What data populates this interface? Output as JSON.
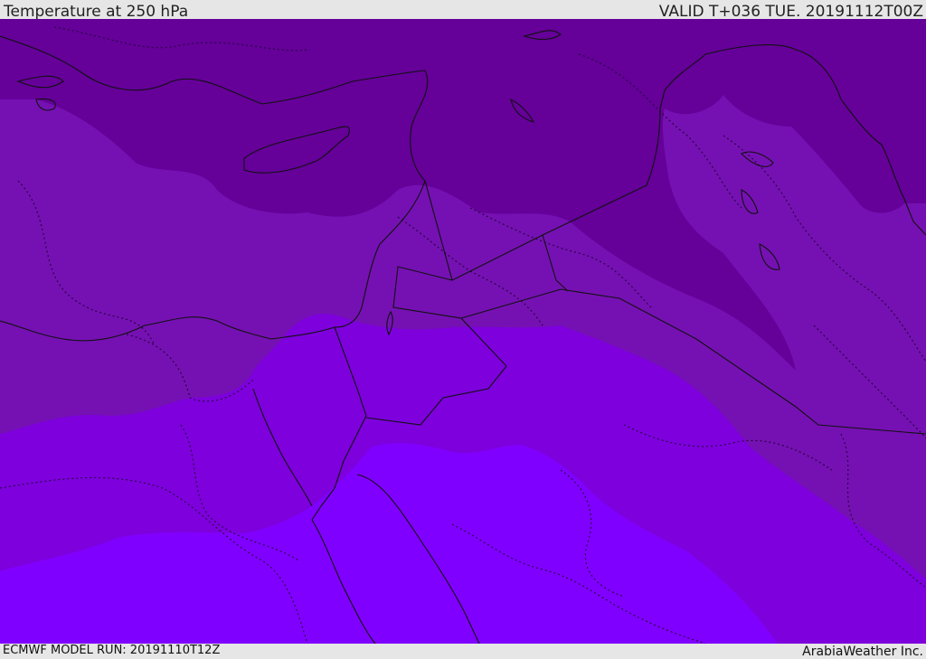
{
  "header": {
    "title": "Temperature at 250 hPa",
    "valid_time": "VALID T+036 TUE. 20191112T00Z"
  },
  "footer": {
    "model_run": "ECMWF MODEL RUN: 20191110T12Z",
    "brand": "ArabiaWeather Inc."
  },
  "map": {
    "fill_colors": {
      "band_darkest": "#650099",
      "band_dark": "#7511b2",
      "band_mid": "#7d00dd",
      "band_light": "#8000ff"
    },
    "border_color": "#111111"
  }
}
